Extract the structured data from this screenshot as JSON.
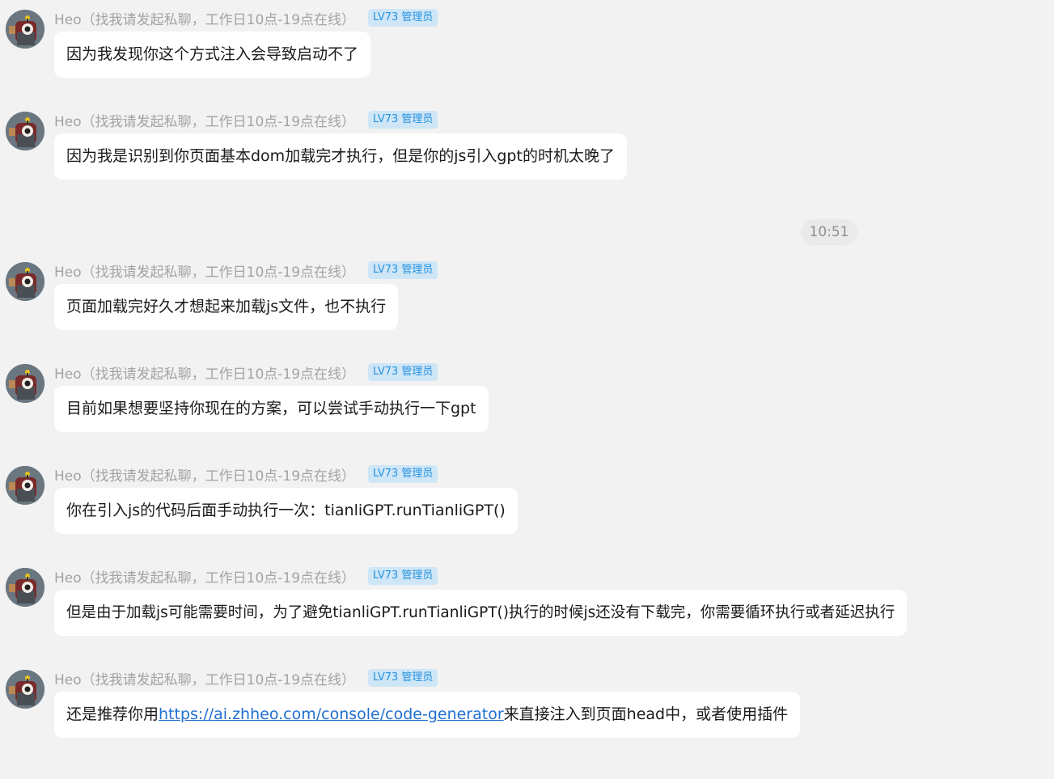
{
  "timestamp": "10:51",
  "messages": [
    {
      "sender": "Heo（找我请发起私聊，工作日10点-19点在线）",
      "badge": "LV73 管理员",
      "text": "因为我发现你这个方式注入会导致启动不了"
    },
    {
      "sender": "Heo（找我请发起私聊，工作日10点-19点在线）",
      "badge": "LV73 管理员",
      "text": "因为我是识别到你页面基本dom加载完才执行，但是你的js引入gpt的时机太晚了"
    },
    {
      "sender": "Heo（找我请发起私聊，工作日10点-19点在线）",
      "badge": "LV73 管理员",
      "text": "页面加载完好久才想起来加载js文件，也不执行"
    },
    {
      "sender": "Heo（找我请发起私聊，工作日10点-19点在线）",
      "badge": "LV73 管理员",
      "text": "目前如果想要坚持你现在的方案，可以尝试手动执行一下gpt"
    },
    {
      "sender": "Heo（找我请发起私聊，工作日10点-19点在线）",
      "badge": "LV73 管理员",
      "text": "你在引入js的代码后面手动执行一次：tianliGPT.runTianliGPT()"
    },
    {
      "sender": "Heo（找我请发起私聊，工作日10点-19点在线）",
      "badge": "LV73 管理员",
      "text": "但是由于加载js可能需要时间，为了避免tianliGPT.runTianliGPT()执行的时候js还没有下载完，你需要循环执行或者延迟执行"
    },
    {
      "sender": "Heo（找我请发起私聊，工作日10点-19点在线）",
      "badge": "LV73 管理员",
      "text_before": "还是推荐你用",
      "link": "https://ai.zhheo.com/console/code-generator",
      "text_after": "来直接注入到页面head中，或者使用插件"
    }
  ]
}
